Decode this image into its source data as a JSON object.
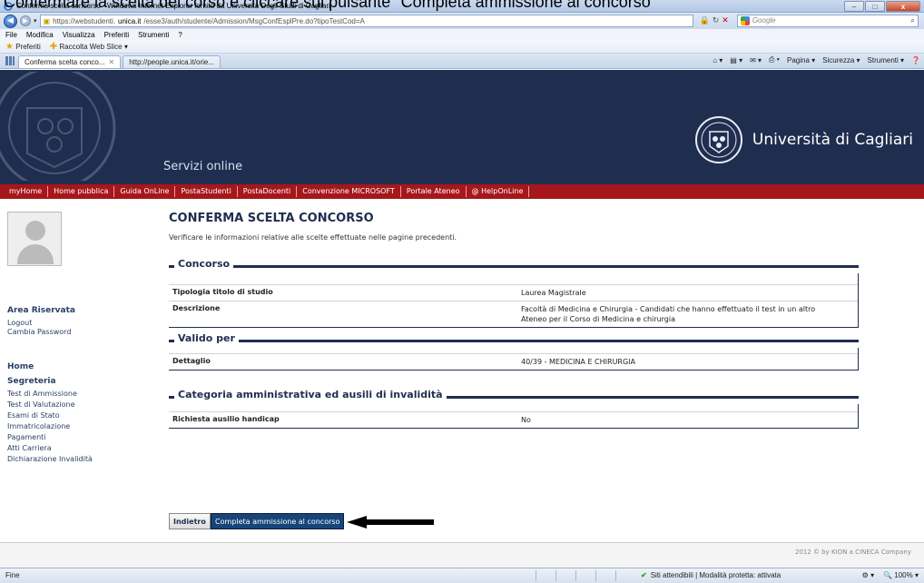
{
  "caption": "Confermare la scelta del corso e cliccare sul pulsante \"Completa ammissione al concorso\"",
  "browser": {
    "title": "Conferma scelta concorso - Windows Internet Explorer fornito da Università Degli Studi di Cagliari",
    "url_prefix": "https://webstudenti.",
    "url_host": "unica.it",
    "url_path": "/esse3/auth/studente/Admission/MsgConfEsplPre.do?tipoTestCod=A",
    "search_placeholder": "Google",
    "menu": [
      "File",
      "Modifica",
      "Visualizza",
      "Preferiti",
      "Strumenti",
      "?"
    ],
    "favorites": [
      "Preferiti",
      "Raccolta Web Slice ▾"
    ],
    "tabs": [
      "Conferma scelta conco...",
      "http://people.unica.it/orie..."
    ],
    "tools": [
      "Pagina ▾",
      "Sicurezza ▾",
      "Strumenti ▾"
    ],
    "status_left": "Fine",
    "status_zone": "Siti attendibili | Modalità protetta: attivata",
    "zoom": "100%"
  },
  "header": {
    "servizi": "Servizi online",
    "university": "Università di Cagliari"
  },
  "nav": [
    "myHome",
    "Home pubblica",
    "Guida OnLine",
    "PostaStudenti",
    "PostaDocenti",
    "Convenzione MICROSOFT",
    "Portale Ateneo",
    "@ HelpOnLine"
  ],
  "sidebar": {
    "area": "Area Riservata",
    "logout": "Logout",
    "password": "Cambia Password",
    "home": "Home",
    "segreteria": "Segreteria",
    "items": [
      "Test di Ammissione",
      "Test di Valutazione",
      "Esami di Stato",
      "Immatricolazione",
      "Pagamenti",
      "Atti Carriera",
      "Dichiarazione Invalidità"
    ]
  },
  "main": {
    "title": "CONFERMA SCELTA CONCORSO",
    "description": "Verificare le informazioni relative alle scelte effettuate nelle pagine precedenti.",
    "sections": [
      {
        "title": "Concorso",
        "rows": [
          {
            "k": "Tipologia titolo di studio",
            "v": "Laurea Magistrale"
          },
          {
            "k": "Descrizione",
            "v": "Facoltà di Medicina e Chirurgia - Candidati che hanno effettuato il test in un altro Ateneo per il Corso di Medicina e chirurgia"
          }
        ]
      },
      {
        "title": "Valido per",
        "rows": [
          {
            "k": "Dettaglio",
            "v": "40/39 - MEDICINA E CHIRURGIA"
          }
        ]
      },
      {
        "title": "Categoria amministrativa ed ausili di invalidità",
        "rows": [
          {
            "k": "Richiesta ausilio handicap",
            "v": "No"
          }
        ]
      }
    ],
    "back_label": "Indietro",
    "submit_label": "Completa ammissione al concorso"
  },
  "footer": {
    "copyright": "2012 © by KION a CINECA Company"
  }
}
